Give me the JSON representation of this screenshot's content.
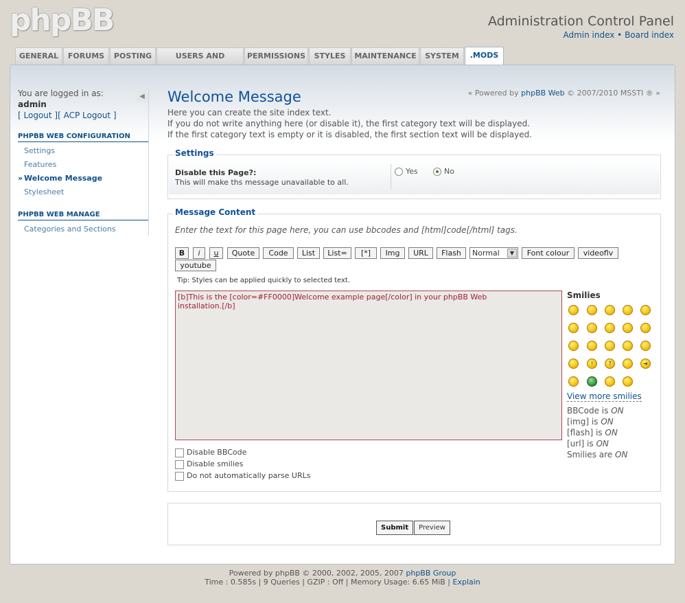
{
  "header": {
    "logo": "phpBB",
    "title": "Administration Control Panel",
    "links": [
      "Admin index",
      "Board index"
    ],
    "separator": "•"
  },
  "tabs": [
    "GENERAL",
    "FORUMS",
    "POSTING",
    "USERS AND GROUPS",
    "PERMISSIONS",
    "STYLES",
    "MAINTENANCE",
    "SYSTEM",
    ".MODS"
  ],
  "active_tab": ".MODS",
  "sidebar": {
    "logged_in_label": "You are logged in as:",
    "username": "admin",
    "logout": "[ Logout ]",
    "acp_logout": "[ ACP Logout ]",
    "collapse_glyph": "◀",
    "section1": "PHPBB WEB CONFIGURATION",
    "section1_items": [
      "Settings",
      "Features",
      "Welcome Message",
      "Stylesheet"
    ],
    "active_item": "Welcome Message",
    "section2": "PHPBB WEB MANAGE",
    "section2_items": [
      "Categories and Sections"
    ]
  },
  "main": {
    "title": "Welcome Message",
    "powered_prefix": "« Powered by",
    "powered_link": "phpBB Web",
    "powered_suffix": "© 2007/2010 MSSTI ® »",
    "intro": [
      "Here you can create the site index text.",
      "If you do not write anything here (or disable it), the first category text will be displayed.",
      "If the first category text is empty or it is disabled, the first section text will be displayed."
    ]
  },
  "settings": {
    "legend": "Settings",
    "label": "Disable this Page?:",
    "help": "This will make ths message unavailable to all.",
    "option_yes": "Yes",
    "option_no": "No",
    "selected": "No"
  },
  "content": {
    "legend": "Message Content",
    "hint": "Enter the text for this page here, you can use bbcodes and [html]code[/html] tags.",
    "buttons": [
      "B",
      "i",
      "u",
      "Quote",
      "Code",
      "List",
      "List=",
      "[*]",
      "Img",
      "URL",
      "Flash"
    ],
    "size_select": "Normal",
    "font_colour": "Font colour",
    "videoflv": "videoflv",
    "youtube": "youtube",
    "tip": "Tip: Styles can be applied quickly to selected text.",
    "textarea_line1": "[b]This is the [color=#FF0000]Welcome example page[/color] in your phpBB Web",
    "textarea_line2": "installation.[/b]",
    "smilies_title": "Smilies",
    "view_more": "View more smilies",
    "bbcode_status": [
      {
        "label": "BBCode is",
        "state": "ON"
      },
      {
        "label": "[img] is",
        "state": "ON"
      },
      {
        "label": "[flash] is",
        "state": "ON"
      },
      {
        "label": "[url] is",
        "state": "ON"
      },
      {
        "label": "Smilies are",
        "state": "ON"
      }
    ],
    "checkboxes": [
      "Disable BBCode",
      "Disable smilies",
      "Do not automatically parse URLs"
    ]
  },
  "actions": {
    "submit": "Submit",
    "preview": "Preview"
  },
  "footer": {
    "line1_prefix": "Powered by phpBB © 2000, 2002, 2005, 2007",
    "line1_link": "phpBB Group",
    "line2_prefix": "Time : 0.585s | 9 Queries | GZIP : Off | Memory Usage: 6.65 MiB |",
    "line2_link": "Explain"
  },
  "colors": {
    "link": "#105289",
    "title": "#115098",
    "textarea_text": "#a0203a"
  }
}
